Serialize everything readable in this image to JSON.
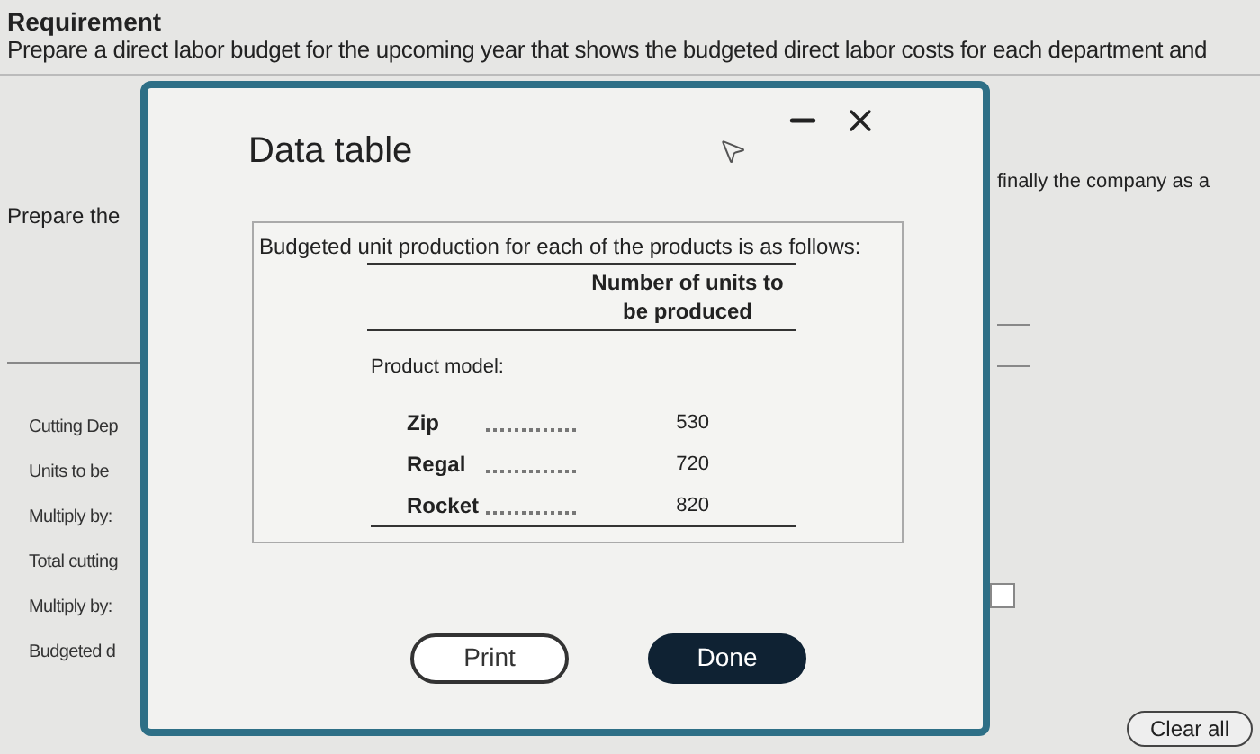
{
  "requirement": {
    "heading": "Requirement",
    "text": "Prepare a direct labor budget for the upcoming year that shows the budgeted direct labor costs for each department and"
  },
  "background": {
    "prompt": "Prepare the",
    "right_text": "finally the company as a",
    "rows": [
      "Cutting Dep",
      "Units to be",
      "Multiply by:",
      "Total cutting",
      "Multiply by:",
      "Budgeted d"
    ],
    "clear_button": "Clear all"
  },
  "dialog": {
    "title": "Data table",
    "caption": "Budgeted unit production for each of the products is as follows:",
    "column_header": "Number of units to be produced",
    "section_label": "Product model:",
    "rows": [
      {
        "name": "Zip",
        "value": "530"
      },
      {
        "name": "Regal",
        "value": "720"
      },
      {
        "name": "Rocket",
        "value": "820"
      }
    ],
    "buttons": [
      {
        "label": "Print",
        "kind": "outline"
      },
      {
        "label": "Done",
        "kind": "filled"
      }
    ]
  }
}
